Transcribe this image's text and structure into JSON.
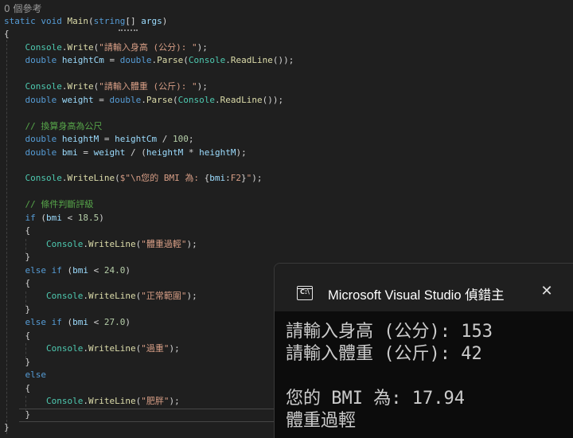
{
  "editor": {
    "references_label": "0 個參考",
    "lines": [
      [
        [
          "kw",
          "static"
        ],
        [
          "pn",
          " "
        ],
        [
          "kw",
          "void"
        ],
        [
          "pn",
          " "
        ],
        [
          "fn",
          "Main"
        ],
        [
          "pn",
          "("
        ],
        [
          "kw",
          "string"
        ],
        [
          "pn",
          "[] "
        ],
        [
          "vr",
          "args"
        ],
        [
          "pn",
          ")"
        ]
      ],
      [
        [
          "pn",
          "{"
        ]
      ],
      [
        [
          "pn",
          "    "
        ],
        [
          "ty",
          "Console"
        ],
        [
          "pn",
          "."
        ],
        [
          "fn",
          "Write"
        ],
        [
          "pn",
          "("
        ],
        [
          "st",
          "\"請輸入身高 (公分): \""
        ],
        [
          "pn",
          ");"
        ]
      ],
      [
        [
          "pn",
          "    "
        ],
        [
          "kw",
          "double"
        ],
        [
          "pn",
          " "
        ],
        [
          "vr",
          "heightCm"
        ],
        [
          "pn",
          " = "
        ],
        [
          "kw",
          "double"
        ],
        [
          "pn",
          "."
        ],
        [
          "fn",
          "Parse"
        ],
        [
          "pn",
          "("
        ],
        [
          "ty",
          "Console"
        ],
        [
          "pn",
          "."
        ],
        [
          "fn",
          "ReadLine"
        ],
        [
          "pn",
          "());"
        ]
      ],
      [],
      [
        [
          "pn",
          "    "
        ],
        [
          "ty",
          "Console"
        ],
        [
          "pn",
          "."
        ],
        [
          "fn",
          "Write"
        ],
        [
          "pn",
          "("
        ],
        [
          "st",
          "\"請輸入體重 (公斤): \""
        ],
        [
          "pn",
          ");"
        ]
      ],
      [
        [
          "pn",
          "    "
        ],
        [
          "kw",
          "double"
        ],
        [
          "pn",
          " "
        ],
        [
          "vr",
          "weight"
        ],
        [
          "pn",
          " = "
        ],
        [
          "kw",
          "double"
        ],
        [
          "pn",
          "."
        ],
        [
          "fn",
          "Parse"
        ],
        [
          "pn",
          "("
        ],
        [
          "ty",
          "Console"
        ],
        [
          "pn",
          "."
        ],
        [
          "fn",
          "ReadLine"
        ],
        [
          "pn",
          "());"
        ]
      ],
      [],
      [
        [
          "pn",
          "    "
        ],
        [
          "cm",
          "// 換算身高為公尺"
        ]
      ],
      [
        [
          "pn",
          "    "
        ],
        [
          "kw",
          "double"
        ],
        [
          "pn",
          " "
        ],
        [
          "vr",
          "heightM"
        ],
        [
          "pn",
          " = "
        ],
        [
          "vr",
          "heightCm"
        ],
        [
          "pn",
          " / "
        ],
        [
          "nm",
          "100"
        ],
        [
          "pn",
          ";"
        ]
      ],
      [
        [
          "pn",
          "    "
        ],
        [
          "kw",
          "double"
        ],
        [
          "pn",
          " "
        ],
        [
          "vr",
          "bmi"
        ],
        [
          "pn",
          " = "
        ],
        [
          "vr",
          "weight"
        ],
        [
          "pn",
          " / ("
        ],
        [
          "vr",
          "heightM"
        ],
        [
          "pn",
          " * "
        ],
        [
          "vr",
          "heightM"
        ],
        [
          "pn",
          ");"
        ]
      ],
      [],
      [
        [
          "pn",
          "    "
        ],
        [
          "ty",
          "Console"
        ],
        [
          "pn",
          "."
        ],
        [
          "fn",
          "WriteLine"
        ],
        [
          "pn",
          "("
        ],
        [
          "st",
          "$\"\\n您的 BMI 為: "
        ],
        [
          "pn",
          "{"
        ],
        [
          "vr",
          "bmi"
        ],
        [
          "pn",
          ":"
        ],
        [
          "st",
          "F2"
        ],
        [
          "pn",
          "}"
        ],
        [
          "st",
          "\""
        ],
        [
          "pn",
          ");"
        ]
      ],
      [],
      [
        [
          "pn",
          "    "
        ],
        [
          "cm",
          "// 條件判斷評級"
        ]
      ],
      [
        [
          "pn",
          "    "
        ],
        [
          "kw",
          "if"
        ],
        [
          "pn",
          " ("
        ],
        [
          "vr",
          "bmi"
        ],
        [
          "pn",
          " < "
        ],
        [
          "nm",
          "18.5"
        ],
        [
          "pn",
          ")"
        ]
      ],
      [
        [
          "pn",
          "    {"
        ]
      ],
      [
        [
          "pn",
          "        "
        ],
        [
          "ty",
          "Console"
        ],
        [
          "pn",
          "."
        ],
        [
          "fn",
          "WriteLine"
        ],
        [
          "pn",
          "("
        ],
        [
          "st",
          "\"體重過輕\""
        ],
        [
          "pn",
          ");"
        ]
      ],
      [
        [
          "pn",
          "    }"
        ]
      ],
      [
        [
          "pn",
          "    "
        ],
        [
          "kw",
          "else"
        ],
        [
          "pn",
          " "
        ],
        [
          "kw",
          "if"
        ],
        [
          "pn",
          " ("
        ],
        [
          "vr",
          "bmi"
        ],
        [
          "pn",
          " < "
        ],
        [
          "nm",
          "24.0"
        ],
        [
          "pn",
          ")"
        ]
      ],
      [
        [
          "pn",
          "    {"
        ]
      ],
      [
        [
          "pn",
          "        "
        ],
        [
          "ty",
          "Console"
        ],
        [
          "pn",
          "."
        ],
        [
          "fn",
          "WriteLine"
        ],
        [
          "pn",
          "("
        ],
        [
          "st",
          "\"正常範圍\""
        ],
        [
          "pn",
          ");"
        ]
      ],
      [
        [
          "pn",
          "    }"
        ]
      ],
      [
        [
          "pn",
          "    "
        ],
        [
          "kw",
          "else"
        ],
        [
          "pn",
          " "
        ],
        [
          "kw",
          "if"
        ],
        [
          "pn",
          " ("
        ],
        [
          "vr",
          "bmi"
        ],
        [
          "pn",
          " < "
        ],
        [
          "nm",
          "27.0"
        ],
        [
          "pn",
          ")"
        ]
      ],
      [
        [
          "pn",
          "    {"
        ]
      ],
      [
        [
          "pn",
          "        "
        ],
        [
          "ty",
          "Console"
        ],
        [
          "pn",
          "."
        ],
        [
          "fn",
          "WriteLine"
        ],
        [
          "pn",
          "("
        ],
        [
          "st",
          "\"過重\""
        ],
        [
          "pn",
          ");"
        ]
      ],
      [
        [
          "pn",
          "    }"
        ]
      ],
      [
        [
          "pn",
          "    "
        ],
        [
          "kw",
          "else"
        ]
      ],
      [
        [
          "pn",
          "    {"
        ]
      ],
      [
        [
          "pn",
          "        "
        ],
        [
          "ty",
          "Console"
        ],
        [
          "pn",
          "."
        ],
        [
          "fn",
          "WriteLine"
        ],
        [
          "pn",
          "("
        ],
        [
          "st",
          "\"肥胖\""
        ],
        [
          "pn",
          ");"
        ]
      ],
      [
        [
          "pn",
          "    }"
        ]
      ],
      [
        [
          "pn",
          "}"
        ]
      ]
    ]
  },
  "console": {
    "title": "Microsoft Visual Studio 偵錯主",
    "icon_label": "C:\\",
    "icon": "console-app-icon",
    "close_icon": "close-icon",
    "output_lines": [
      "請輸入身高 (公分): 153",
      "請輸入體重 (公斤): 42",
      "",
      "您的 BMI 為: 17.94",
      "體重過輕"
    ]
  },
  "colors": {
    "editor_background": "#1f1f1f",
    "keyword": "#569cd6",
    "type": "#4ec9b0",
    "method": "#dcdcaa",
    "string": "#d69d85",
    "number": "#b5cea8",
    "comment": "#57a64a",
    "variable": "#9cdcfe",
    "console_background": "#0c0c0c"
  }
}
